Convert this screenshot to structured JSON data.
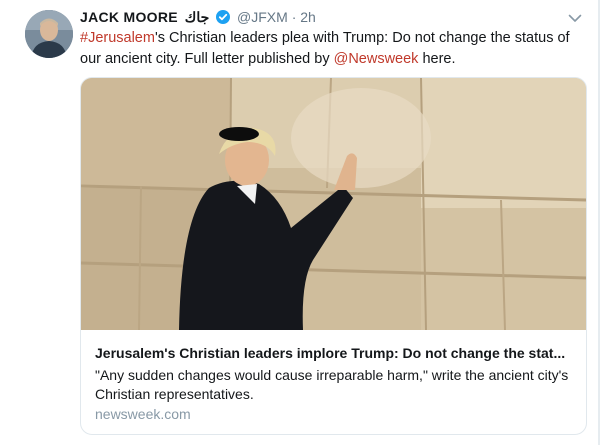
{
  "tweet": {
    "author_name": "JACK MOORE",
    "author_name_arabic": "جاك",
    "handle": "@JFXM",
    "separator": "·",
    "time": "2h",
    "text": {
      "hashtag": "#Jerusalem",
      "part1": "'s Christian leaders plea with Trump: Do not change the status of our ancient city. Full letter published by ",
      "mention": "@Newsweek",
      "part2": " here."
    },
    "card": {
      "title": "Jerusalem's Christian leaders implore Trump: Do not change the stat...",
      "description": "\"Any sudden changes would cause irreparable harm,\" write the ancient city's Christian representatives.",
      "domain": "newsweek.com"
    }
  },
  "icons": {
    "verified": "verified-badge-icon",
    "caret": "chevron-down-icon"
  },
  "colors": {
    "link": "#c0392b",
    "verified": "#1da1f2",
    "muted": "#657786",
    "domain": "#8899a6"
  }
}
